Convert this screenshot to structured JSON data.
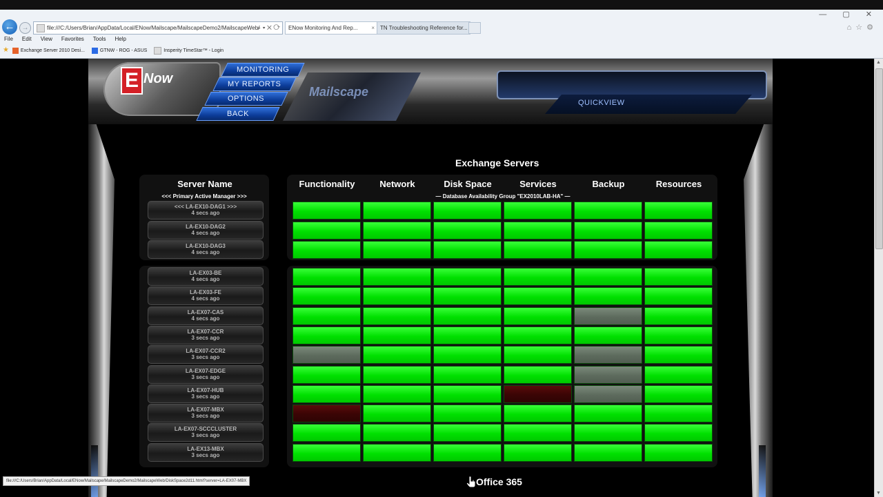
{
  "browser": {
    "address": "file:///C:/Users/Brian/AppData/Local/ENow/Mailscape/MailscapeDemo2/MailscapeWeb/",
    "address_controls": "⌕ ▾ ✕ ⟳",
    "tabs": [
      {
        "label": "ENow Monitoring And Rep..."
      },
      {
        "label": "TN Troubleshooting Reference for..."
      }
    ],
    "menu": [
      "File",
      "Edit",
      "View",
      "Favorites",
      "Tools",
      "Help"
    ],
    "favorites": [
      "Exchange Server 2010 Desi...",
      "GTNW - ROG - ASUS",
      "Insperity TimeStar™ - Login"
    ],
    "window_controls": "— ▢ ✕",
    "status_url": "file:///C:/Users/Brian/AppData/Local/ENow/Mailscape/MailscapeDemo2/MailscapeWeb/DiskSpace2d11.html?server=LA-EX07-MBX"
  },
  "header": {
    "logo_letter": "E",
    "logo_text": "Now",
    "nav": [
      "MONITORING",
      "MY REPORTS",
      "OPTIONS",
      "BACK"
    ],
    "product_text": "Mailscape",
    "quickview": "QUICKVIEW"
  },
  "content": {
    "title": "Exchange Servers",
    "server_header": "Server Name",
    "primary_manager": "<<< Primary Active Manager >>>",
    "dag_label": "— Database Availability Group \"EX2010LAB-HA\" —",
    "columns": [
      "Functionality",
      "Network",
      "Disk Space",
      "Services",
      "Backup",
      "Resources"
    ],
    "dag_servers": [
      {
        "name": "<<< LA-EX10-DAG1 >>>",
        "time": "4 secs ago",
        "status": [
          "green",
          "green",
          "green",
          "green",
          "green",
          "green"
        ]
      },
      {
        "name": "LA-EX10-DAG2",
        "time": "4 secs ago",
        "status": [
          "green",
          "green",
          "green",
          "green",
          "green",
          "green"
        ]
      },
      {
        "name": "LA-EX10-DAG3",
        "time": "4 secs ago",
        "status": [
          "green",
          "green",
          "green",
          "green",
          "green",
          "green"
        ]
      }
    ],
    "servers": [
      {
        "name": "LA-EX03-BE",
        "time": "4 secs ago",
        "status": [
          "green",
          "green",
          "green",
          "green",
          "green",
          "green"
        ]
      },
      {
        "name": "LA-EX03-FE",
        "time": "4 secs ago",
        "status": [
          "green",
          "green",
          "green",
          "green",
          "green",
          "green"
        ]
      },
      {
        "name": "LA-EX07-CAS",
        "time": "4 secs ago",
        "status": [
          "green",
          "green",
          "green",
          "green",
          "gray",
          "green"
        ]
      },
      {
        "name": "LA-EX07-CCR",
        "time": "3 secs ago",
        "status": [
          "green",
          "green",
          "green",
          "green",
          "green",
          "green"
        ]
      },
      {
        "name": "LA-EX07-CCR2",
        "time": "3 secs ago",
        "status": [
          "gray",
          "green",
          "green",
          "green",
          "gray",
          "green"
        ]
      },
      {
        "name": "LA-EX07-EDGE",
        "time": "3 secs ago",
        "status": [
          "green",
          "green",
          "green",
          "green",
          "gray",
          "green"
        ]
      },
      {
        "name": "LA-EX07-HUB",
        "time": "3 secs ago",
        "status": [
          "green",
          "green",
          "green",
          "red",
          "gray",
          "green"
        ]
      },
      {
        "name": "LA-EX07-MBX",
        "time": "3 secs ago",
        "status": [
          "red",
          "green",
          "green",
          "green",
          "green",
          "green"
        ]
      },
      {
        "name": "LA-EX07-SCCCLUSTER",
        "time": "3 secs ago",
        "status": [
          "green",
          "green",
          "green",
          "green",
          "green",
          "green"
        ]
      },
      {
        "name": "LA-EX13-MBX",
        "time": "3 secs ago",
        "status": [
          "green",
          "green",
          "green",
          "green",
          "green",
          "green"
        ]
      }
    ],
    "footer_section": "Office 365"
  },
  "colors": {
    "ok": "#00e000",
    "warning": "#5d6b5d",
    "critical": "#3a0505",
    "nav_blue": "#0d3d9a"
  }
}
